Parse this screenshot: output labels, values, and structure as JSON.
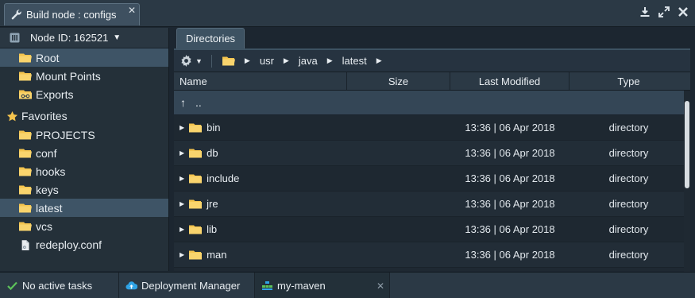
{
  "window": {
    "tab_title": "Build node : configs",
    "close_glyph": "✕",
    "actions": [
      "download-icon",
      "expand-icon",
      "close-icon"
    ]
  },
  "left": {
    "node_label": "Node ID: 162521",
    "roots": [
      {
        "label": "Root",
        "selected": true
      },
      {
        "label": "Mount Points",
        "selected": false
      },
      {
        "label": "Exports",
        "selected": false
      }
    ],
    "favorites_label": "Favorites",
    "favorites": [
      {
        "label": "PROJECTS",
        "kind": "folder",
        "selected": false
      },
      {
        "label": "conf",
        "kind": "folder",
        "selected": false
      },
      {
        "label": "hooks",
        "kind": "folder",
        "selected": false
      },
      {
        "label": "keys",
        "kind": "folder",
        "selected": false
      },
      {
        "label": "latest",
        "kind": "folder",
        "selected": true
      },
      {
        "label": "vcs",
        "kind": "folder",
        "selected": false
      },
      {
        "label": "redeploy.conf",
        "kind": "file",
        "selected": false
      }
    ]
  },
  "right": {
    "tab_label": "Directories",
    "breadcrumb": [
      "usr",
      "java",
      "latest"
    ],
    "columns": {
      "name": "Name",
      "size": "Size",
      "modified": "Last Modified",
      "type": "Type"
    },
    "up_label": "..",
    "up_glyph": "↑",
    "rows": [
      {
        "name": "bin",
        "size": "",
        "modified": "13:36 | 06 Apr 2018",
        "type": "directory"
      },
      {
        "name": "db",
        "size": "",
        "modified": "13:36 | 06 Apr 2018",
        "type": "directory"
      },
      {
        "name": "include",
        "size": "",
        "modified": "13:36 | 06 Apr 2018",
        "type": "directory"
      },
      {
        "name": "jre",
        "size": "",
        "modified": "13:36 | 06 Apr 2018",
        "type": "directory"
      },
      {
        "name": "lib",
        "size": "",
        "modified": "13:36 | 06 Apr 2018",
        "type": "directory"
      },
      {
        "name": "man",
        "size": "",
        "modified": "13:36 | 06 Apr 2018",
        "type": "directory"
      }
    ]
  },
  "bottom": {
    "tasks_label": "No active tasks",
    "deploy_label": "Deployment Manager",
    "env_label": "my-maven",
    "env_close": "✕"
  },
  "colors": {
    "folder": "#f4c44e",
    "accent_selection": "#3e5466",
    "check_green": "#5cc15a",
    "cloud_blue": "#2fa3e6"
  }
}
